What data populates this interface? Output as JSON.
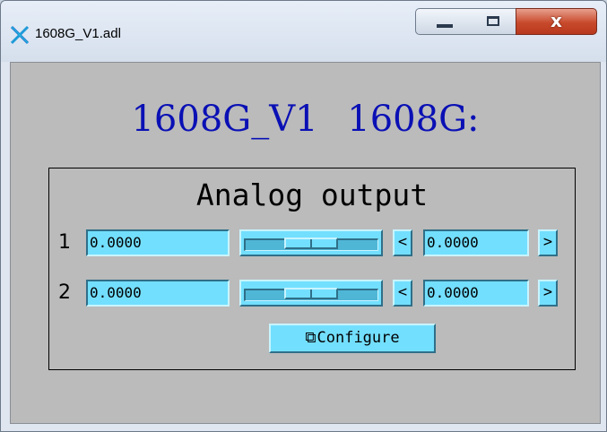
{
  "window": {
    "title": "1608G_V1.adl",
    "app_icon": "medm-x-icon",
    "controls": {
      "minimize": "minimize-icon",
      "maximize": "maximize-icon",
      "close": "close-icon",
      "close_glyph": "x"
    }
  },
  "display": {
    "title": "1608G_V1  1608G:",
    "title_color": "#0a10b4",
    "background": "#bbbbbb"
  },
  "panel": {
    "title": "Analog output",
    "rows": [
      {
        "label": "1",
        "value": "0.0000",
        "slider_level": 0.5,
        "decrement": "<",
        "tweak_value": "0.0000",
        "increment": ">"
      },
      {
        "label": "2",
        "value": "0.0000",
        "slider_level": 0.5,
        "decrement": "<",
        "tweak_value": "0.0000",
        "increment": ">"
      }
    ],
    "configure": {
      "icon": "related-display-icon",
      "icon_glyph": "⧉",
      "label": "Configure"
    }
  },
  "colors": {
    "control": "#73dfff",
    "monitor_text": "#000000"
  }
}
